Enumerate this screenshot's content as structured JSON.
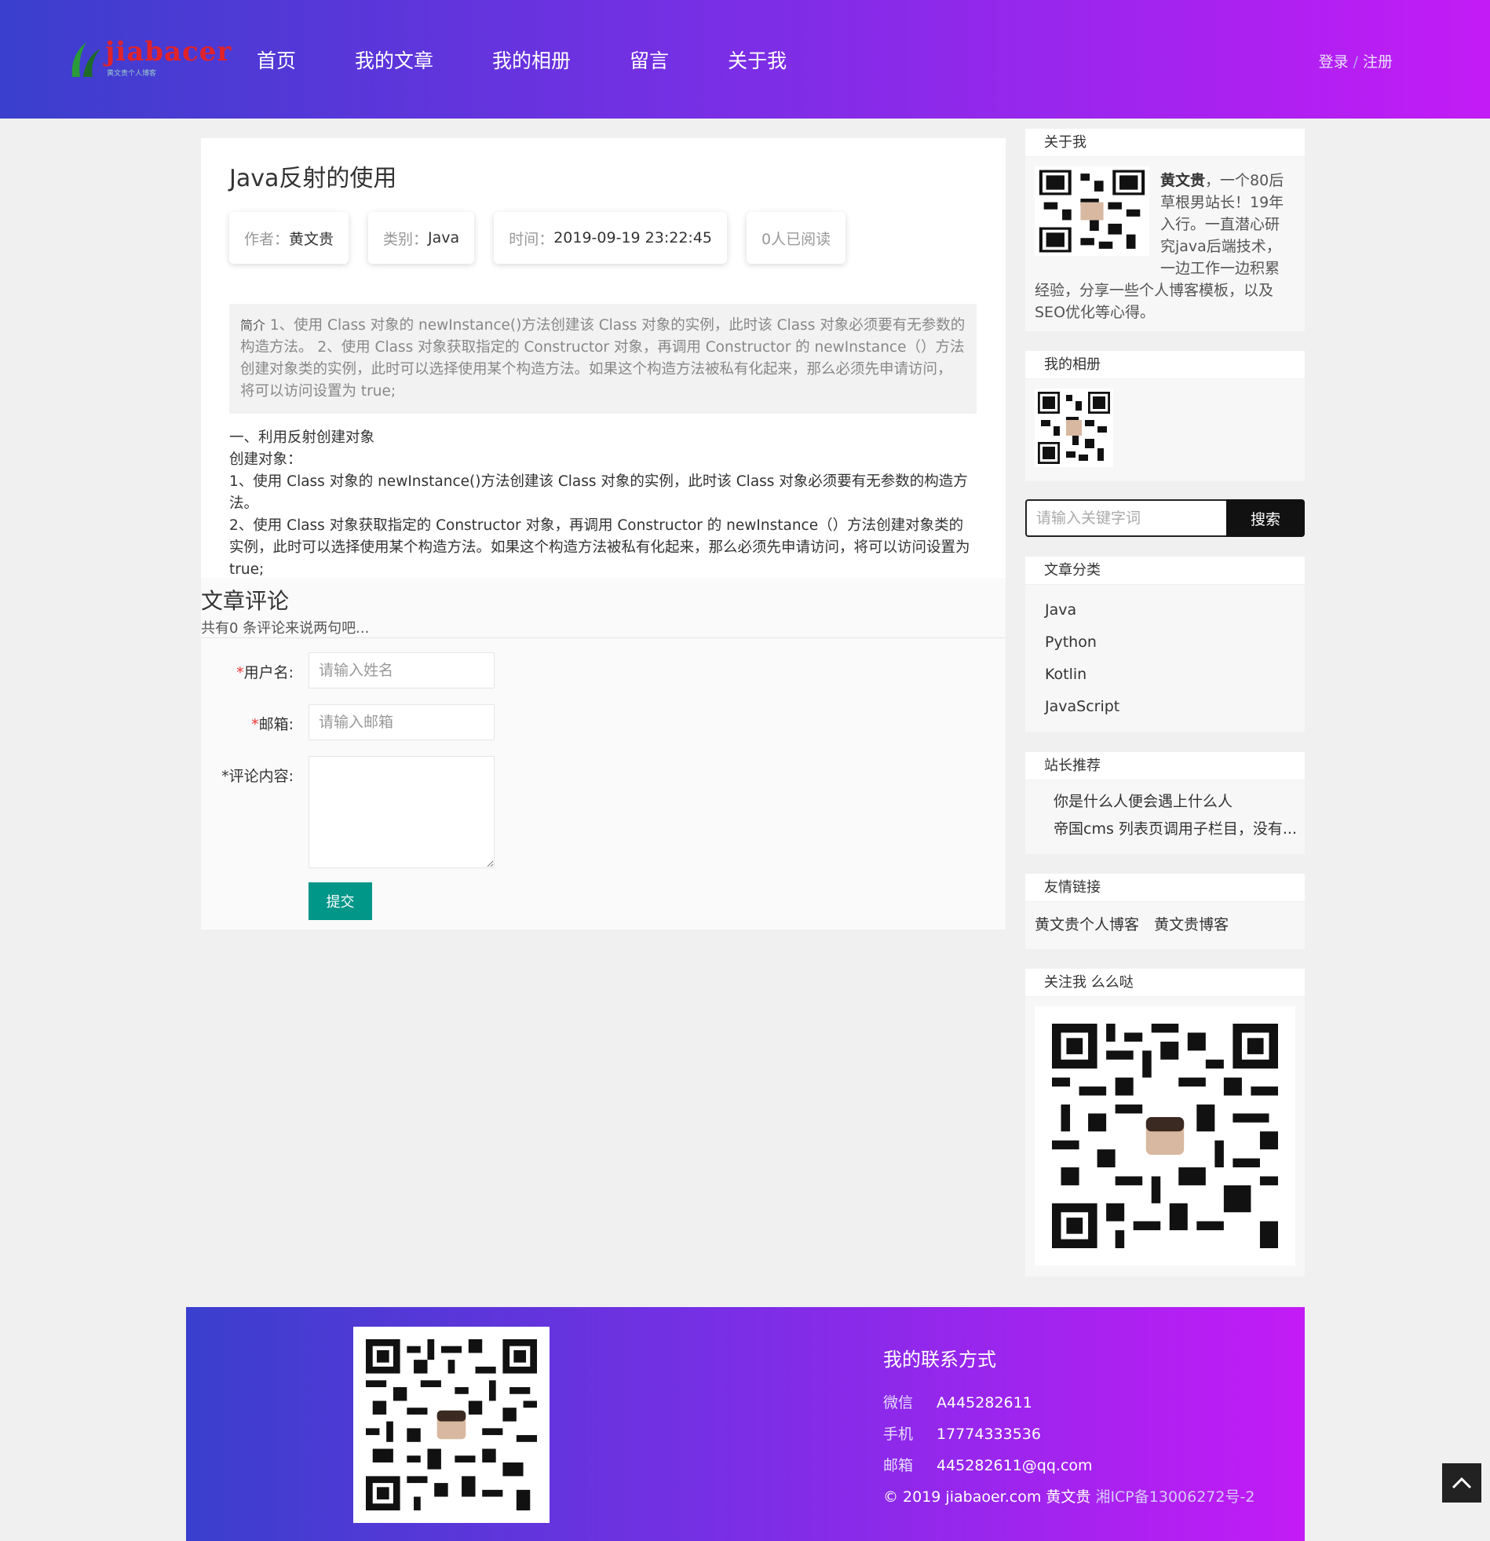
{
  "brand": {
    "logo_text": "jiabacer",
    "logo_sub": "黄文贵个人博客"
  },
  "nav": {
    "items": [
      {
        "label": "首页"
      },
      {
        "label": "我的文章"
      },
      {
        "label": "我的相册"
      },
      {
        "label": "留言"
      },
      {
        "label": "关于我"
      }
    ],
    "login": "登录",
    "separator": "/",
    "register": "注册"
  },
  "article": {
    "title": "Java反射的使用",
    "meta": {
      "author_key": "作者：",
      "author": "黄文贵",
      "category_key": "类别：",
      "category": "Java",
      "time_key": "时间：",
      "time": "2019-09-19 23:22:45",
      "reads": "0人已阅读"
    },
    "summary_label": "简介",
    "summary": "1、使用 Class 对象的 newInstance()方法创建该 Class 对象的实例，此时该 Class 对象必须要有无参数的构造方法。 2、使用 Class 对象获取指定的 Constructor 对象，再调用 Constructor 的 newInstance（）方法创建对象类的实例，此时可以选择使用某个构造方法。如果这个构造方法被私有化起来，那么必须先申请访问，将可以访问设置为 true;",
    "body": [
      "一、利用反射创建对象",
      "创建对象：",
      "1、使用 Class 对象的 newInstance()方法创建该 Class 对象的实例，此时该 Class 对象必须要有无参数的构造方法。",
      "2、使用 Class 对象获取指定的 Constructor 对象，再调用 Constructor 的 newInstance（）方法创建对象类的实例，此时可以选择使用某个构造方法。如果这个构造方法被私有化起来，那么必须先申请访问，将可以访问设置为 true;"
    ]
  },
  "comments": {
    "title": "文章评论",
    "count_text": "共有0 条评论来说两句吧...",
    "username_label": "用户名:",
    "username_placeholder": "请输入姓名",
    "email_label": "邮箱:",
    "email_placeholder": "请输入邮箱",
    "content_label": "*评论内容:",
    "required_mark": "*",
    "submit": "提交"
  },
  "sidebar": {
    "about": {
      "title": "关于我",
      "name": "黄文贵",
      "text": "，一个80后草根男站长！19年入行。一直潜心研究java后端技术，一边工作一边积累经验，分享一些个人博客模板，以及SEO优化等心得。"
    },
    "album": {
      "title": "我的相册"
    },
    "search": {
      "placeholder": "请输入关键字词",
      "button": "搜索"
    },
    "categories": {
      "title": "文章分类",
      "items": [
        "Java",
        "Python",
        "Kotlin",
        "JavaScript"
      ]
    },
    "recommend": {
      "title": "站长推荐",
      "items": [
        "你是什么人便会遇上什么人",
        "帝国cms 列表页调用子栏目，没有..."
      ]
    },
    "links": {
      "title": "友情链接",
      "items": [
        "黄文贵个人博客",
        "黄文贵博客"
      ]
    },
    "follow": {
      "title": "关注我 么么哒"
    }
  },
  "footer": {
    "title": "我的联系方式",
    "wechat_key": "微信",
    "wechat": "A445282611",
    "phone_key": "手机",
    "phone": "17774333536",
    "email_key": "邮箱",
    "email": "445282611@qq.com",
    "copyright": "© 2019 jiabaoer.com 黄文贵",
    "icp": "湘ICP备13006272号-2"
  },
  "colors": {
    "header_gradient_start": "#3a3fcd",
    "header_gradient_end": "#c31bf5",
    "submit_button": "#009688",
    "search_button": "#111111"
  },
  "icons": {
    "back_to_top": "chevron-up-icon"
  }
}
